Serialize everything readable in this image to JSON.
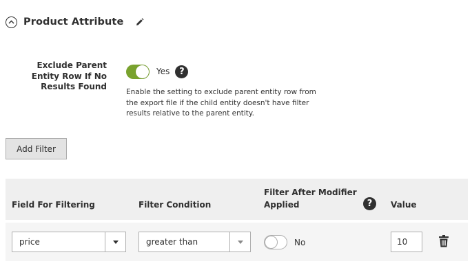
{
  "section": {
    "title": "Product Attribute"
  },
  "exclude_setting": {
    "label": "Exclude Parent Entity Row If No Results Found",
    "toggle_state": "Yes",
    "help": "?",
    "note": "Enable the setting to exclude parent entity row from the export file if the child entity doesn't have filter results relative to the parent entity."
  },
  "add_filter_label": "Add Filter",
  "grid": {
    "columns": {
      "field": "Field For Filtering",
      "condition": "Filter Condition",
      "modifier": "Filter After Modifier Applied",
      "value": "Value"
    },
    "help": "?",
    "rows": [
      {
        "field": "price",
        "condition": "greater than",
        "modifier_state": "No",
        "value": "10"
      }
    ]
  },
  "colors": {
    "toggle_on": "#79a22e",
    "button_bg": "#e3e3e3",
    "header_bg": "#efefef",
    "row_bg": "#f5f5f5",
    "text": "#303030"
  }
}
